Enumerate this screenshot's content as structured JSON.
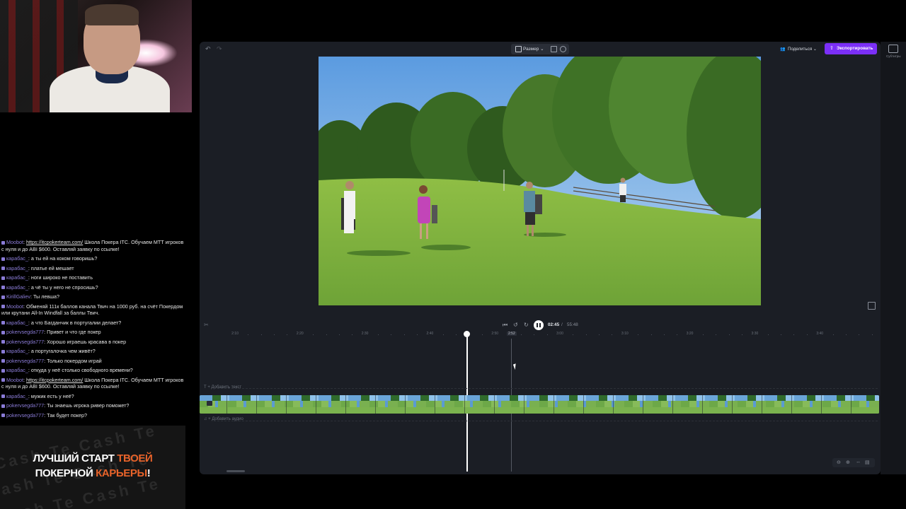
{
  "chat": [
    {
      "user": "Moobot",
      "text": "https://itcpokerteam.com/ Школа Покера ITC. Обучаем МТТ игроков с нуля и до ABI $600. Оставляй заявку по ссылке!",
      "link": "https://itcpokerteam.com/",
      "rest": " Школа Покера ITC. Обучаем МТТ игроков с нуля и до ABI $600. Оставляй заявку по ссылке!"
    },
    {
      "user": "карабас_",
      "text": "а ты ей на коком говоришь?"
    },
    {
      "user": "карабас_",
      "text": "платье ей мешает"
    },
    {
      "user": "карабас_",
      "text": "ноги широко не поставить"
    },
    {
      "user": "карабас_",
      "text": "а чё ты у него не спросишь?"
    },
    {
      "user": "KirillGaliev",
      "text": "Ты левша?"
    },
    {
      "user": "Moobot",
      "text": "Обменяй 111к баллов канала Твич на 1000 руб. на счёт Покердом или крутани All-In Windfall за баллы Твич."
    },
    {
      "user": "карабас_",
      "text": "а что Багданчик в португалии делает?"
    },
    {
      "user": "pokervsegda777",
      "text": "Привет и что где покер"
    },
    {
      "user": "pokervsegda777",
      "text": "Хорошо играешь красава в покер"
    },
    {
      "user": "карабас_",
      "text": "а португалочка чем живёт?"
    },
    {
      "user": "pokervsegda777",
      "text": "Только покердом играй"
    },
    {
      "user": "карабас_",
      "text": "откуда у неё столько свободного времени?"
    },
    {
      "user": "Moobot",
      "link": "https://itcpokerteam.com/",
      "rest": " Школа Покера ITC. Обучаем МТТ игроков с нуля и до ABI $600. Оставляй заявку по ссылке!"
    },
    {
      "user": "карабас_",
      "text": "мужик есть у неё?"
    },
    {
      "user": "pokervsegda777",
      "text": "Ты знаешь игрока ривер поможет?"
    },
    {
      "user": "pokervsegda777",
      "text": "Так будет покер?"
    }
  ],
  "promo": {
    "line1_a": "ЛУЧШИЙ СТАРТ ",
    "line1_b": "ТВОЕЙ",
    "line2_a": "ПОКЕРНОЙ ",
    "line2_b": "КАРЬЕРЫ",
    "line2_c": "!",
    "background_words": "Cash  Te  Cash  Te"
  },
  "editor": {
    "size_label": "Размер",
    "share_label": "Поделиться",
    "export_label": "Экспортировать",
    "rail_label": "Субтитры",
    "time_current": "02:45",
    "time_separator": " / ",
    "time_total": "55:48",
    "hover_time": "2:52",
    "ruler_ticks": [
      "2:10",
      "2:20",
      "2:30",
      "2:40",
      "2:50",
      "3:00",
      "3:10",
      "3:20",
      "3:30",
      "3:40"
    ],
    "add_text": "+ Добавить текст",
    "add_audio": "+ Добавить аудио"
  },
  "colors": {
    "accent_purple": "#7b2ff7",
    "promo_orange": "#e8632a",
    "editor_bg": "#1b1e25"
  },
  "icons": [
    "undo-icon",
    "redo-icon",
    "resize-icon",
    "share-people-icon",
    "export-upload-icon",
    "play-pause-icon",
    "skip-back-icon",
    "rewind-icon",
    "forward-icon",
    "fullscreen-icon",
    "zoom-in-icon",
    "zoom-out-icon",
    "fit-icon"
  ]
}
